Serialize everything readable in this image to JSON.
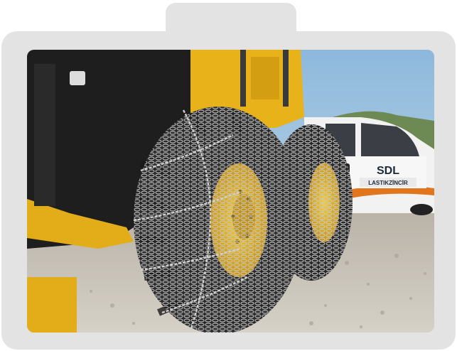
{
  "photo": {
    "alt_icon": "photo-icon",
    "van_logo_text": "SDL",
    "van_sub_text": "LASTIKZİNCİR",
    "colors": {
      "frame": "#e3e3e4",
      "sky": "#9ec3de",
      "machine_yellow": "#e8b21a",
      "tire": "#2a2a2a",
      "rim": "#e0b020",
      "gravel": "#c9c4ba",
      "van": "#f2f2f2",
      "van_stripe": "#e2761e"
    }
  }
}
